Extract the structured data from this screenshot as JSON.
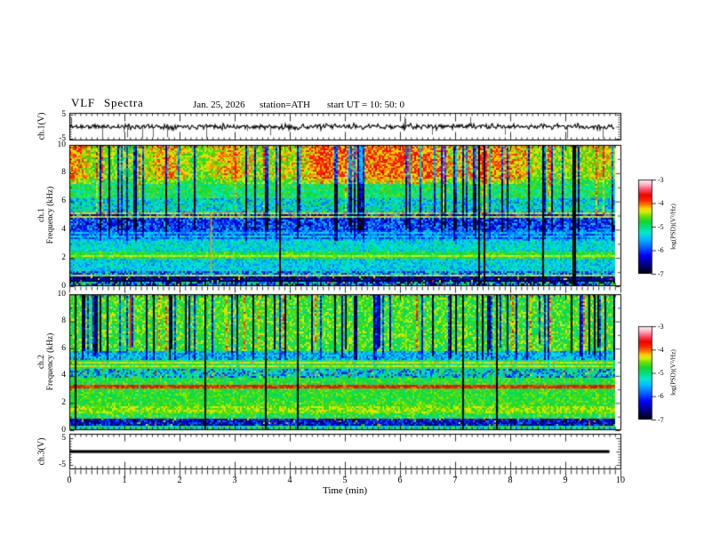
{
  "chart_data": {
    "type": "heatmap",
    "subtype": "vlf-spectrogram-multipanel",
    "title": "VLF  Spectra",
    "header": {
      "date": "Jan. 25, 2026",
      "station": "station=ATH",
      "start_ut": "start UT =  10: 50: 0"
    },
    "x_axis": {
      "label": "Time (min)",
      "min": 0,
      "max": 10,
      "tick_labels": [
        "0",
        "1",
        "2",
        "3",
        "4",
        "5",
        "6",
        "7",
        "8",
        "9",
        "10"
      ],
      "minor_per_major": 9,
      "data_end_min": 9.9
    },
    "colorbar": {
      "label": "log(PSD)(V²/Hz)",
      "tick_labels": [
        "-3",
        "-4",
        "-5",
        "-6",
        "-7"
      ],
      "value_range": [
        -7,
        -3
      ],
      "stops": [
        [
          0,
          "#000000"
        ],
        [
          0.1,
          "#000080"
        ],
        [
          0.2,
          "#0000ff"
        ],
        [
          0.3,
          "#0070ff"
        ],
        [
          0.38,
          "#00c0ff"
        ],
        [
          0.44,
          "#00e8d0"
        ],
        [
          0.5,
          "#00e080"
        ],
        [
          0.56,
          "#10d830"
        ],
        [
          0.62,
          "#70e000"
        ],
        [
          0.66,
          "#d0f000"
        ],
        [
          0.7,
          "#ffd000"
        ],
        [
          0.74,
          "#ff7000"
        ],
        [
          0.79,
          "#ff2000"
        ],
        [
          0.84,
          "#f00000"
        ],
        [
          0.9,
          "#ff5070"
        ],
        [
          0.95,
          "#ffb0c0"
        ],
        [
          1,
          "#fff4f6"
        ]
      ]
    },
    "panels": [
      {
        "kind": "waveform",
        "ylabel": "ch.1(V)",
        "ymin": -5,
        "ymax": 5,
        "ytick_labels": [
          "5",
          "-5"
        ],
        "ytick_values": [
          5,
          -5
        ],
        "seed": 11,
        "noise_amp": 0.55,
        "spike_prob": 0.05,
        "spike_max": 5
      },
      {
        "kind": "spectrogram",
        "channel": "ch.1",
        "ylabel_ch": "ch.1",
        "ylabel_freq": "Frequency (kHz)",
        "ymin": 0,
        "ymax": 10,
        "ytick_labels": [
          "10",
          "8",
          "6",
          "4",
          "2",
          "0"
        ],
        "ytick_values": [
          10,
          8,
          6,
          4,
          2,
          0
        ],
        "seed": 23,
        "warm": true,
        "top_salt": true,
        "bands": [
          {
            "f0": 0,
            "f1": 0.18,
            "t": 0.05,
            "n": 0.05,
            "sm": 0
          },
          {
            "f0": 0.18,
            "f1": 0.5,
            "t": 0.3,
            "n": 0.3,
            "sm": 0,
            "salt": true
          },
          {
            "f0": 0.5,
            "f1": 0.75,
            "t": 0.13,
            "n": 0.12,
            "sm": 0,
            "salt": true
          },
          {
            "f0": 0.75,
            "f1": 1.1,
            "t": 0.32,
            "n": 0.18,
            "sm": 0
          },
          {
            "f0": 1.1,
            "f1": 2.05,
            "t": 0.41,
            "n": 0.1,
            "sm": 0.15
          },
          {
            "f0": 2.05,
            "f1": 2.5,
            "t": 0.56,
            "n": 0.08,
            "sm": 0.15
          },
          {
            "f0": 2.5,
            "f1": 3.2,
            "t": 0.43,
            "n": 0.1,
            "sm": 0.25
          },
          {
            "f0": 3.2,
            "f1": 3.95,
            "t": 0.34,
            "n": 0.1,
            "sm": 0.4,
            "stripe": true
          },
          {
            "f0": 3.95,
            "f1": 5.1,
            "t": 0.25,
            "n": 0.15,
            "sm": 0.6
          },
          {
            "f0": 5.1,
            "f1": 6.3,
            "t": 0.43,
            "n": 0.15,
            "sm": 0.9
          },
          {
            "f0": 6.3,
            "f1": 7.6,
            "t": 0.53,
            "n": 0.1,
            "sm": 1
          },
          {
            "f0": 7.6,
            "f1": 10,
            "t": 0.6,
            "n": 0.1,
            "sm": 1
          }
        ],
        "hlines": [
          {
            "f": 5.15,
            "w": 0.07,
            "t": 0.7
          },
          {
            "f": 4.95,
            "w": 0.05,
            "t": 0.68
          },
          {
            "f": 2.2,
            "w": 0.06,
            "t": 0.66
          },
          {
            "f": 1.0,
            "w": 0.06,
            "t": 0.7
          },
          {
            "f": 0.85,
            "w": 0.05,
            "t": 0.64
          },
          {
            "f": 0.62,
            "w": 0.05,
            "t": 0.05
          },
          {
            "f": 0.4,
            "w": 0.04,
            "t": 0.06
          }
        ],
        "vlines": [
          {
            "x": 2.56,
            "f0": 1.0,
            "f1": 5.2,
            "t": 0.72
          }
        ],
        "streaks": {
          "prob": 0.2,
          "depth_min": 0.28,
          "depth_max": 0.55,
          "fmin": 3.6,
          "full_prob": 0.15
        }
      },
      {
        "kind": "spectrogram",
        "channel": "ch.2",
        "ylabel_ch": "ch.2",
        "ylabel_freq": "Frequency (kHz)",
        "ymin": 0,
        "ymax": 10,
        "ytick_labels": [
          "10",
          "8",
          "6",
          "4",
          "2",
          "0"
        ],
        "ytick_values": [
          10,
          8,
          6,
          4,
          2,
          0
        ],
        "seed": 57,
        "warm": false,
        "top_salt": true,
        "bands": [
          {
            "f0": 0,
            "f1": 0.12,
            "t": 0.08,
            "n": 0.06,
            "sm": 0
          },
          {
            "f0": 0.12,
            "f1": 0.38,
            "t": 0.48,
            "n": 0.15,
            "sm": 0
          },
          {
            "f0": 0.38,
            "f1": 0.92,
            "t": 0.17,
            "n": 0.14,
            "sm": 0,
            "salt": true
          },
          {
            "f0": 0.92,
            "f1": 1.3,
            "t": 0.55,
            "n": 0.1,
            "sm": 0.06
          },
          {
            "f0": 1.3,
            "f1": 1.42,
            "t": 0.6,
            "n": 0.06,
            "sm": 0.06
          },
          {
            "f0": 1.42,
            "f1": 1.8,
            "t": 0.63,
            "n": 0.07,
            "sm": 0.06
          },
          {
            "f0": 1.8,
            "f1": 2.1,
            "t": 0.58,
            "n": 0.07,
            "sm": 0.06
          },
          {
            "f0": 2.1,
            "f1": 3.15,
            "t": 0.57,
            "n": 0.07,
            "sm": 0.06
          },
          {
            "f0": 3.15,
            "f1": 3.32,
            "t": 0.8,
            "n": 0.06,
            "sm": 0
          },
          {
            "f0": 3.32,
            "f1": 3.95,
            "t": 0.56,
            "n": 0.08,
            "sm": 0.06
          },
          {
            "f0": 3.95,
            "f1": 4.5,
            "t": 0.4,
            "n": 0.2,
            "sm": 0.1,
            "salt": true
          },
          {
            "f0": 4.5,
            "f1": 5.15,
            "t": 0.52,
            "n": 0.1,
            "sm": 0.15
          },
          {
            "f0": 5.15,
            "f1": 5.85,
            "t": 0.37,
            "n": 0.12,
            "sm": 0.5
          },
          {
            "f0": 5.85,
            "f1": 10,
            "t": 0.58,
            "n": 0.1,
            "sm": 1
          }
        ],
        "hlines": [
          {
            "f": 4.95,
            "w": 0.06,
            "t": 0.68
          },
          {
            "f": 4.75,
            "w": 0.05,
            "t": 0.66
          },
          {
            "f": 1.95,
            "w": 0.05,
            "t": 0.7
          },
          {
            "f": 1.35,
            "w": 0.05,
            "t": 0.62
          },
          {
            "f": 0.05,
            "w": 0.05,
            "t": 0.84
          }
        ],
        "vlines": [
          {
            "x": 1.26,
            "f0": 0.9,
            "f1": 4.4,
            "t": 0.48
          },
          {
            "x": 1.1,
            "f0": 6,
            "f1": 10,
            "t": 0.82
          }
        ],
        "streaks": {
          "prob": 0.26,
          "depth_min": 0.3,
          "depth_max": 0.62,
          "fmin": 5.3,
          "full_prob": 0.12,
          "left_bias": 0.6
        }
      },
      {
        "kind": "flatline",
        "ylabel": "ch.3(V)",
        "ymin": -5,
        "ymax": 5,
        "ytick_labels": [
          "5",
          "-5"
        ],
        "ytick_values": [
          5,
          -5
        ],
        "value": 0,
        "x_end_min": 9.8,
        "line_color": "#000000",
        "thickness": 3.2
      }
    ]
  }
}
